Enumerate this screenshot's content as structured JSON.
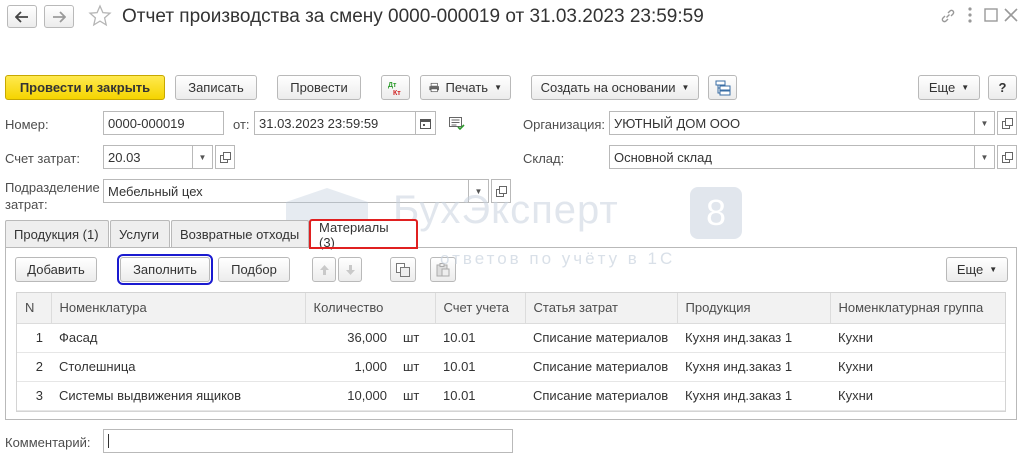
{
  "window": {
    "title": "Отчет производства за смену 0000-000019 от 31.03.2023 23:59:59"
  },
  "toolbar": {
    "post_close": "Провести и закрыть",
    "save": "Записать",
    "post": "Провести",
    "dt_kt": "Дт Кт",
    "print": "Печать",
    "create_based": "Создать на основании",
    "more": "Еще",
    "help": "?"
  },
  "form": {
    "number_label": "Номер:",
    "number_value": "0000-000019",
    "date_label": "от:",
    "date_value": "31.03.2023 23:59:59",
    "org_label": "Организация:",
    "org_value": "УЮТНЫЙ ДОМ ООО",
    "cost_account_label": "Счет затрат:",
    "cost_account_value": "20.03",
    "warehouse_label": "Склад:",
    "warehouse_value": "Основной склад",
    "division_label_1": "Подразделение",
    "division_label_2": "затрат:",
    "division_value": "Мебельный цех",
    "comment_label": "Комментарий:",
    "comment_value": ""
  },
  "watermark": {
    "main": "БухЭксперт",
    "digit": "8",
    "sub": "ответов по учёту в 1С"
  },
  "tabs": [
    {
      "label": "Продукция (1)"
    },
    {
      "label": "Услуги"
    },
    {
      "label": "Возвратные отходы"
    },
    {
      "label": "Материалы (3)"
    }
  ],
  "table_toolbar": {
    "add": "Добавить",
    "fill": "Заполнить",
    "select": "Подбор",
    "more": "Еще"
  },
  "table": {
    "columns": [
      "N",
      "Номенклатура",
      "Количество",
      "",
      "Счет учета",
      "Статья затрат",
      "Продукция",
      "Номенклатурная группа"
    ],
    "rows": [
      {
        "n": "1",
        "item": "Фасад",
        "qty": "36,000",
        "unit": "шт",
        "account": "10.01",
        "cost_item": "Списание материалов",
        "product": "Кухня инд.заказ 1",
        "group": "Кухни"
      },
      {
        "n": "2",
        "item": "Столешница",
        "qty": "1,000",
        "unit": "шт",
        "account": "10.01",
        "cost_item": "Списание материалов",
        "product": "Кухня инд.заказ 1",
        "group": "Кухни"
      },
      {
        "n": "3",
        "item": "Системы выдвижения ящиков",
        "qty": "10,000",
        "unit": "шт",
        "account": "10.01",
        "cost_item": "Списание материалов",
        "product": "Кухня инд.заказ 1",
        "group": "Кухни"
      }
    ]
  },
  "colors": {
    "primary_button": "#f5d400",
    "active_tab_outline": "#e02020",
    "fill_button_outline": "#1a1ad0",
    "dt_kt_green": "#2a9a2a",
    "dt_kt_red": "#d02020"
  }
}
